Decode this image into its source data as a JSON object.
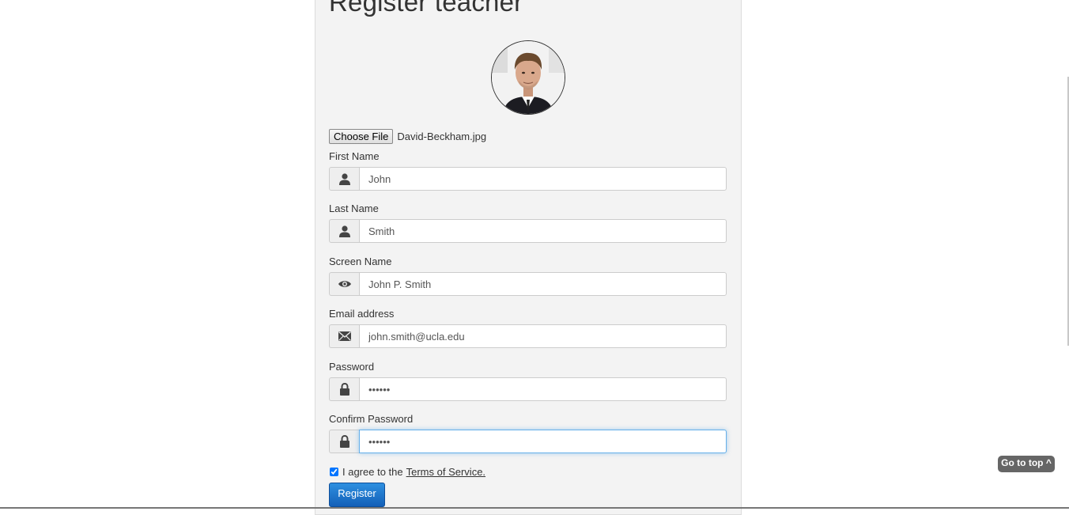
{
  "page": {
    "title": "Register teacher"
  },
  "avatar": {
    "alt": "profile photo"
  },
  "file": {
    "button_label": "Choose File",
    "file_name": "David-Beckham.jpg"
  },
  "fields": [
    {
      "label": "First Name",
      "value": "John",
      "icon": "user-icon"
    },
    {
      "label": "Last Name",
      "value": "Smith",
      "icon": "user-icon"
    },
    {
      "label": "Screen Name",
      "value": "John P. Smith",
      "icon": "eye-icon"
    },
    {
      "label": "Email address",
      "value": "john.smith@ucla.edu",
      "icon": "envelope-icon"
    },
    {
      "label": "Password",
      "value": "••••••",
      "icon": "lock-icon"
    },
    {
      "label": "Confirm Password",
      "value": "••••••",
      "icon": "lock-icon"
    }
  ],
  "terms": {
    "prefix": "I agree to the",
    "link": "Terms of Service.",
    "checked": true
  },
  "register": {
    "label": "Register"
  },
  "go_top": {
    "label": "Go to top ^"
  },
  "colors": {
    "primary": "#1a73d1",
    "panel": "#f3f3f3",
    "focus": "#66afe9"
  }
}
